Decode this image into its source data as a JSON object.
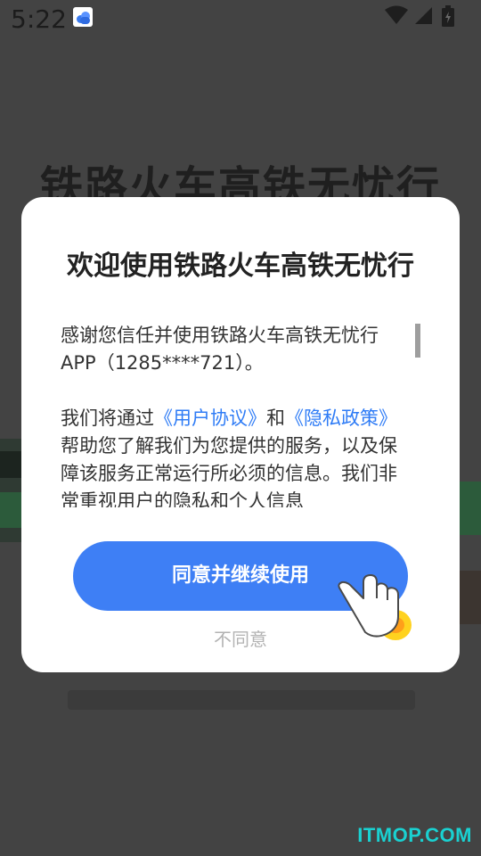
{
  "status_bar": {
    "time": "5:22",
    "icons": [
      "app-notification-icon",
      "wifi-icon",
      "signal-icon",
      "battery-icon"
    ]
  },
  "background": {
    "title": "铁路火车高铁无忧行"
  },
  "dialog": {
    "title": "欢迎使用铁路火车高铁无忧行",
    "para1": "感谢您信任并使用铁路火车高铁无忧行APP（1285****721）。",
    "para2_before": "我们将通过",
    "link_user_agreement": "《用户协议》",
    "para2_and": "和",
    "link_privacy_policy": "《隐私政策》",
    "para2_after": "帮助您了解我们为您提供的服务，以及保障该服务正常运行所必须的信息。我们非常重视用户的隐私和个人信息",
    "agree_button": "同意并继续使用",
    "disagree_button": "不同意",
    "hand_icon": "pointing-hand-icon"
  },
  "watermark": "ITMOP.COM",
  "colors": {
    "overlay": "#434343",
    "dialog_bg": "#ffffff",
    "primary": "#3e7ff5",
    "link": "#2f7cf6",
    "disagree_text": "#b3b3b3",
    "watermark": "#1ad1d1"
  }
}
